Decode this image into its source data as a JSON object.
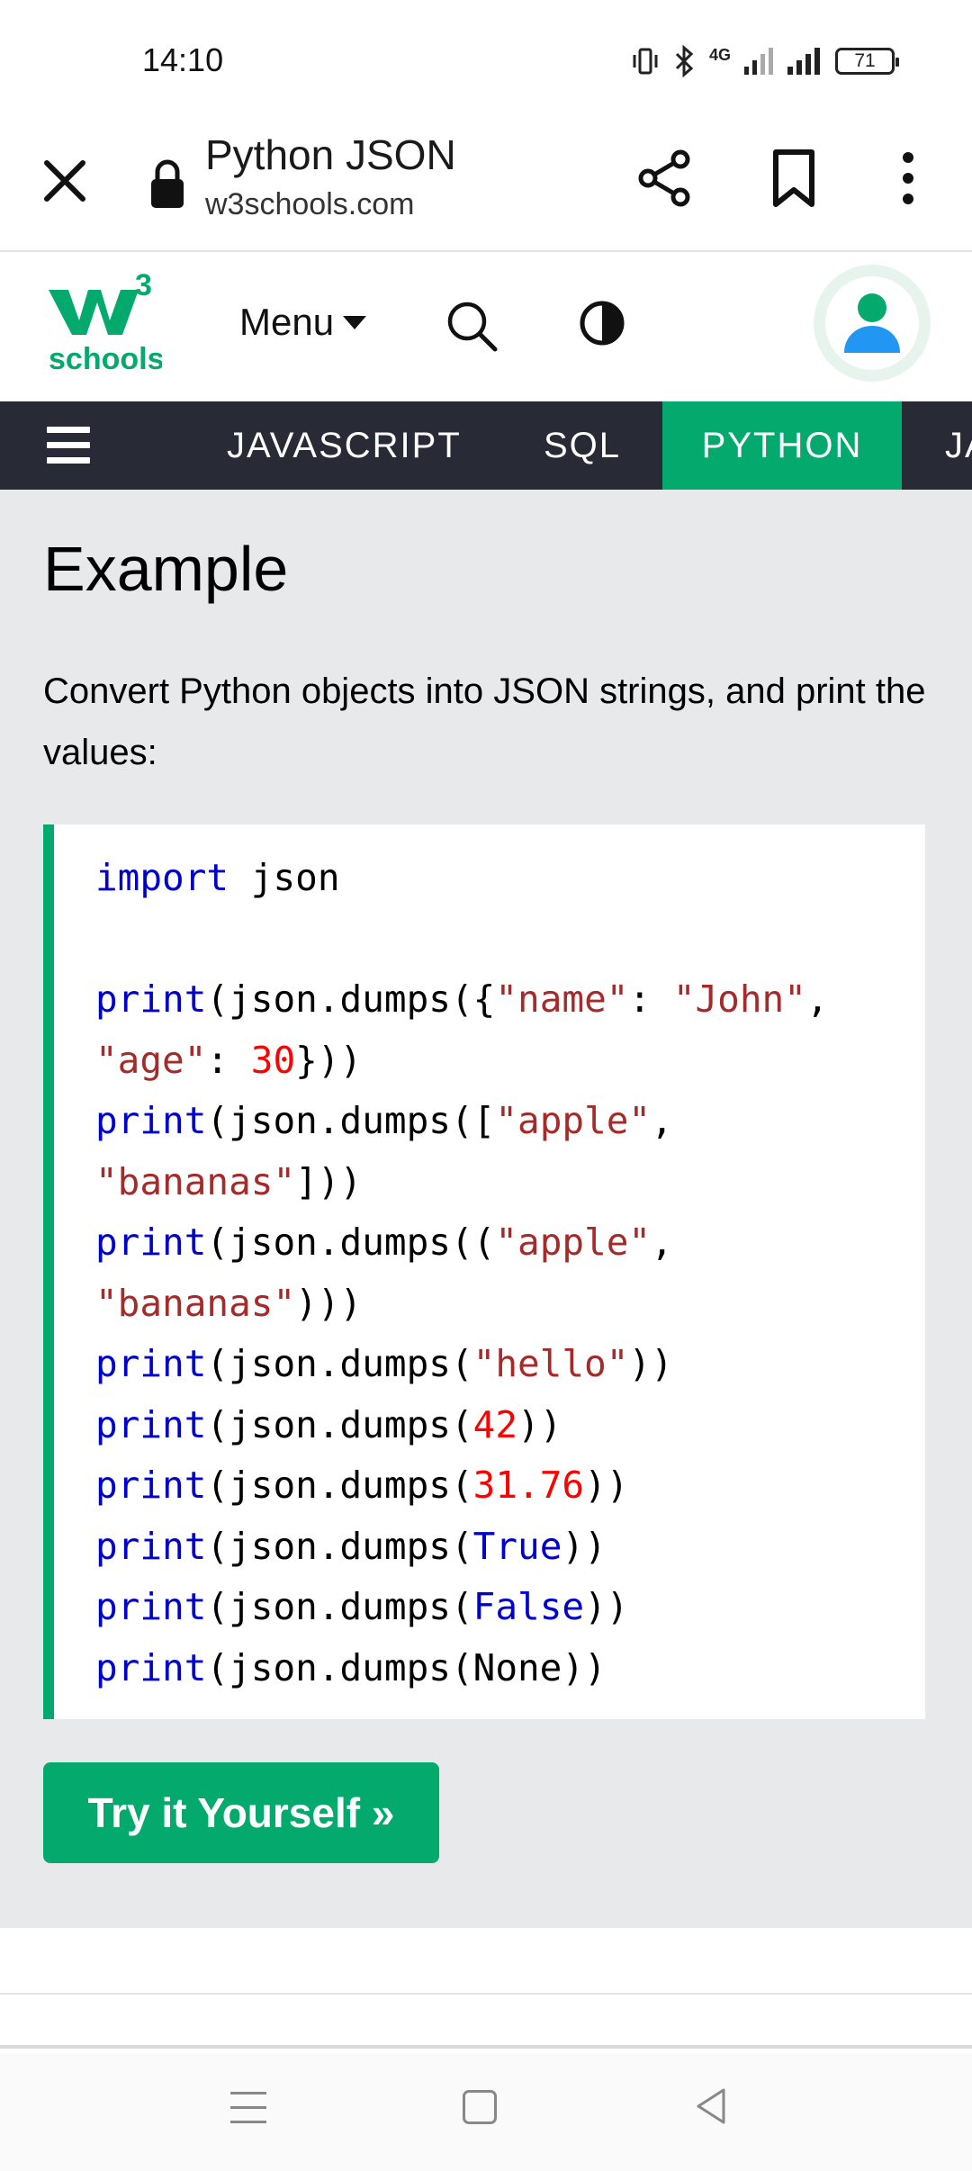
{
  "status_bar": {
    "time": "14:10",
    "network": "4G",
    "battery": "71"
  },
  "browser": {
    "title": "Python JSON",
    "url": "w3schools.com"
  },
  "site_header": {
    "logo_text": "schools",
    "logo_superscript": "3",
    "menu_label": "Menu"
  },
  "nav": {
    "tabs": [
      {
        "label": "JAVASCRIPT"
      },
      {
        "label": "SQL"
      },
      {
        "label": "PYTHON",
        "active": true
      },
      {
        "label": "JA"
      }
    ]
  },
  "content": {
    "heading": "Example",
    "description": "Convert Python objects into JSON strings, and print the values:",
    "code_lines": [
      [
        {
          "t": "import",
          "c": "kw"
        },
        {
          "t": " json",
          "c": ""
        }
      ],
      [],
      [
        {
          "t": "print",
          "c": "kw"
        },
        {
          "t": "(json.dumps({",
          "c": ""
        },
        {
          "t": "\"name\"",
          "c": "str"
        },
        {
          "t": ": ",
          "c": ""
        },
        {
          "t": "\"John\"",
          "c": "str"
        },
        {
          "t": ",",
          "c": ""
        }
      ],
      [
        {
          "t": "\"age\"",
          "c": "str"
        },
        {
          "t": ": ",
          "c": ""
        },
        {
          "t": "30",
          "c": "num"
        },
        {
          "t": "}))",
          "c": ""
        }
      ],
      [
        {
          "t": "print",
          "c": "kw"
        },
        {
          "t": "(json.dumps([",
          "c": ""
        },
        {
          "t": "\"apple\"",
          "c": "str"
        },
        {
          "t": ",",
          "c": ""
        }
      ],
      [
        {
          "t": "\"bananas\"",
          "c": "str"
        },
        {
          "t": "]))",
          "c": ""
        }
      ],
      [
        {
          "t": "print",
          "c": "kw"
        },
        {
          "t": "(json.dumps((",
          "c": ""
        },
        {
          "t": "\"apple\"",
          "c": "str"
        },
        {
          "t": ",",
          "c": ""
        }
      ],
      [
        {
          "t": "\"bananas\"",
          "c": "str"
        },
        {
          "t": ")))",
          "c": ""
        }
      ],
      [
        {
          "t": "print",
          "c": "kw"
        },
        {
          "t": "(json.dumps(",
          "c": ""
        },
        {
          "t": "\"hello\"",
          "c": "str"
        },
        {
          "t": "))",
          "c": ""
        }
      ],
      [
        {
          "t": "print",
          "c": "kw"
        },
        {
          "t": "(json.dumps(",
          "c": ""
        },
        {
          "t": "42",
          "c": "num"
        },
        {
          "t": "))",
          "c": ""
        }
      ],
      [
        {
          "t": "print",
          "c": "kw"
        },
        {
          "t": "(json.dumps(",
          "c": ""
        },
        {
          "t": "31.76",
          "c": "num"
        },
        {
          "t": "))",
          "c": ""
        }
      ],
      [
        {
          "t": "print",
          "c": "kw"
        },
        {
          "t": "(json.dumps(",
          "c": ""
        },
        {
          "t": "True",
          "c": "kw"
        },
        {
          "t": "))",
          "c": ""
        }
      ],
      [
        {
          "t": "print",
          "c": "kw"
        },
        {
          "t": "(json.dumps(",
          "c": ""
        },
        {
          "t": "False",
          "c": "kw"
        },
        {
          "t": "))",
          "c": ""
        }
      ],
      [
        {
          "t": "print",
          "c": "kw"
        },
        {
          "t": "(json.dumps(None))",
          "c": ""
        }
      ]
    ],
    "try_button": "Try it Yourself »"
  },
  "colors": {
    "accent": "#04aa6d",
    "nav_bg": "#282a35",
    "content_bg": "#e7e9eb",
    "keyword": "#0000cd",
    "string": "#a52a2a",
    "number": "#ff0000"
  },
  "icons": {
    "close": "close-icon",
    "lock": "lock-icon",
    "share": "share-icon",
    "bookmark": "bookmark-icon",
    "more": "more-vert-icon",
    "search": "search-icon",
    "contrast": "contrast-icon",
    "avatar": "user-icon",
    "hamburger": "hamburger-icon"
  }
}
